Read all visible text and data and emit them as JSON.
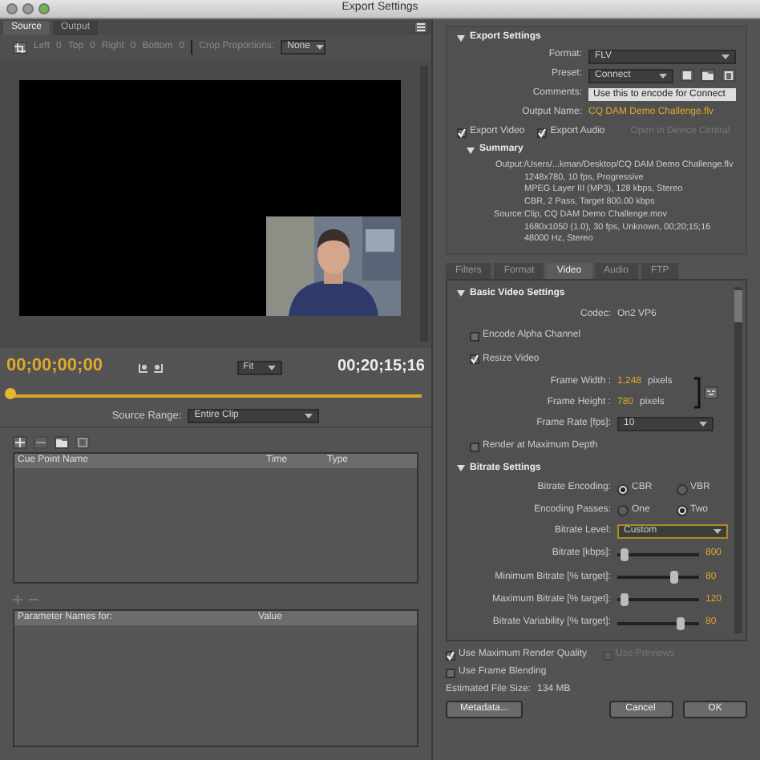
{
  "window": {
    "title": "Export Settings"
  },
  "source_tabs": [
    {
      "label": "Source",
      "selected": true
    },
    {
      "label": "Output",
      "selected": false
    }
  ],
  "crop_toolbar": {
    "fields": [
      {
        "label": "Left",
        "value": "0"
      },
      {
        "label": "Top",
        "value": "0"
      },
      {
        "label": "Right",
        "value": "0"
      },
      {
        "label": "Bottom",
        "value": "0"
      }
    ],
    "proportions_label": "Crop Proportions:",
    "proportions_value": "None"
  },
  "timeline": {
    "current": "00;00;00;00",
    "zoom": "Fit",
    "duration": "00;20;15;16",
    "level": 0
  },
  "source_range": {
    "label": "Source Range:",
    "value": "Entire Clip"
  },
  "cue_table": {
    "columns": [
      "Cue Point Name",
      "Time",
      "Type"
    ]
  },
  "param_table": {
    "columns": [
      "Parameter Names for:",
      "Value"
    ]
  },
  "export_settings": {
    "title": "Export Settings",
    "format": {
      "label": "Format:",
      "value": "FLV"
    },
    "preset": {
      "label": "Preset:",
      "value": "Connect"
    },
    "comments": {
      "label": "Comments:",
      "value": "Use this to encode for Connect"
    },
    "output_name": {
      "label": "Output Name:",
      "value": "CQ DAM Demo Challenge.flv"
    },
    "export_video": {
      "label": "Export Video",
      "checked": true
    },
    "export_audio": {
      "label": "Export Audio",
      "checked": true
    },
    "device_central": {
      "label": "Open in Device Central",
      "disabled": true
    },
    "summary": {
      "title": "Summary",
      "output_label": "Output:",
      "output_lines": [
        "/Users/...kman/Desktop/CQ DAM Demo Challenge.flv",
        "1248x780, 10 fps, Progressive",
        "MPEG Layer III (MP3), 128 kbps, Stereo",
        "CBR, 2 Pass, Target 800.00 kbps"
      ],
      "source_label": "Source:",
      "source_lines": [
        "Clip, CQ DAM Demo Challenge.mov",
        "1680x1050 (1.0), 30 fps, Unknown, 00;20;15;16",
        "48000 Hz, Stereo"
      ]
    }
  },
  "settings_tabs": [
    {
      "label": "Filters",
      "selected": false
    },
    {
      "label": "Format",
      "selected": false
    },
    {
      "label": "Video",
      "selected": true
    },
    {
      "label": "Audio",
      "selected": false
    },
    {
      "label": "FTP",
      "selected": false
    }
  ],
  "basic_video": {
    "title": "Basic Video Settings",
    "codec_label": "Codec:",
    "codec_value": "On2 VP6",
    "encode_alpha": {
      "label": "Encode Alpha Channel",
      "checked": false
    },
    "resize": {
      "label": "Resize Video",
      "checked": true
    },
    "frame_width": {
      "label": "Frame Width :",
      "value": "1,248",
      "unit": "pixels"
    },
    "frame_height": {
      "label": "Frame Height :",
      "value": "780",
      "unit": "pixels"
    },
    "frame_rate": {
      "label": "Frame Rate [fps]:",
      "value": "10"
    },
    "render_depth": {
      "label": "Render at Maximum Depth",
      "checked": false
    }
  },
  "bitrate": {
    "title": "Bitrate Settings",
    "encoding": {
      "label": "Bitrate Encoding:",
      "options": [
        {
          "label": "CBR",
          "selected": true
        },
        {
          "label": "VBR",
          "selected": false
        }
      ]
    },
    "passes": {
      "label": "Encoding Passes:",
      "options": [
        {
          "label": "One",
          "selected": false
        },
        {
          "label": "Two",
          "selected": true
        }
      ]
    },
    "level": {
      "label": "Bitrate Level:",
      "value": "Custom"
    },
    "sliders": [
      {
        "label": "Bitrate [kbps]:",
        "level": 0.04,
        "reading": "800"
      },
      {
        "label": "Minimum Bitrate [% target]:",
        "level": 0.72,
        "reading": "80"
      },
      {
        "label": "Maximum Bitrate [% target]:",
        "level": 0.04,
        "reading": "120"
      },
      {
        "label": "Bitrate Variability [% target]:",
        "level": 0.8,
        "reading": "80"
      }
    ]
  },
  "max_quality": {
    "label": "Use Maximum Render Quality",
    "checked": true
  },
  "previews": {
    "label": "Use Previews",
    "checked": false,
    "disabled": true
  },
  "frame_blending": {
    "label": "Use Frame Blending",
    "checked": false
  },
  "file_size": {
    "label": "Estimated File Size:",
    "value": "134 MB"
  },
  "buttons": [
    "Metadata...",
    "Cancel",
    "OK"
  ]
}
